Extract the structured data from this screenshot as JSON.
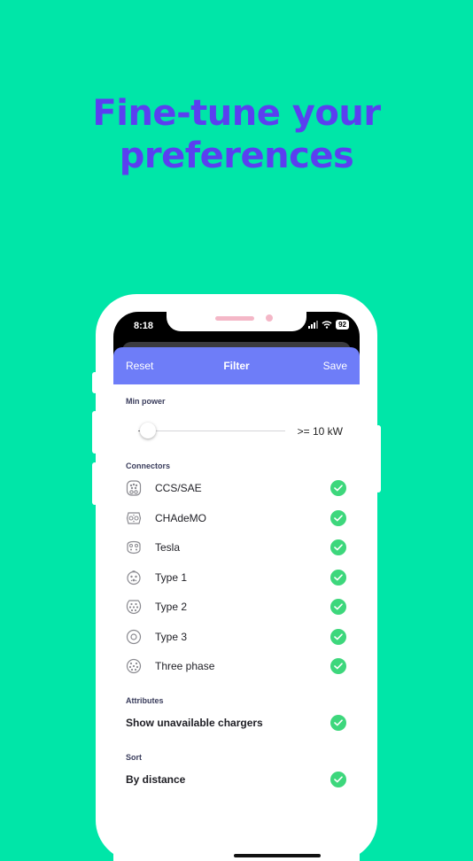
{
  "headline": {
    "line1": "Fine-tune your",
    "line2": "preferences"
  },
  "status_bar": {
    "time": "8:18",
    "battery": "92"
  },
  "navbar": {
    "reset": "Reset",
    "title": "Filter",
    "save": "Save"
  },
  "min_power": {
    "label": "Min power",
    "value_text": ">= 10 kW",
    "slider_position": 0.04
  },
  "connectors": {
    "label": "Connectors",
    "items": [
      {
        "name": "CCS/SAE",
        "icon": "ccs-sae-icon",
        "checked": true
      },
      {
        "name": "CHAdeMO",
        "icon": "chademo-icon",
        "checked": true
      },
      {
        "name": "Tesla",
        "icon": "tesla-icon",
        "checked": true
      },
      {
        "name": "Type 1",
        "icon": "type1-icon",
        "checked": true
      },
      {
        "name": "Type 2",
        "icon": "type2-icon",
        "checked": true
      },
      {
        "name": "Type 3",
        "icon": "type3-icon",
        "checked": true
      },
      {
        "name": "Three phase",
        "icon": "three-phase-icon",
        "checked": true
      }
    ]
  },
  "attributes": {
    "label": "Attributes",
    "items": [
      {
        "name": "Show unavailable chargers",
        "checked": true
      }
    ]
  },
  "sort": {
    "label": "Sort",
    "items": [
      {
        "name": "By distance",
        "checked": true
      }
    ]
  },
  "colors": {
    "background": "#00E6A8",
    "headline": "#5B3FF0",
    "navbar": "#6E7DF8",
    "check": "#3DD77C"
  }
}
